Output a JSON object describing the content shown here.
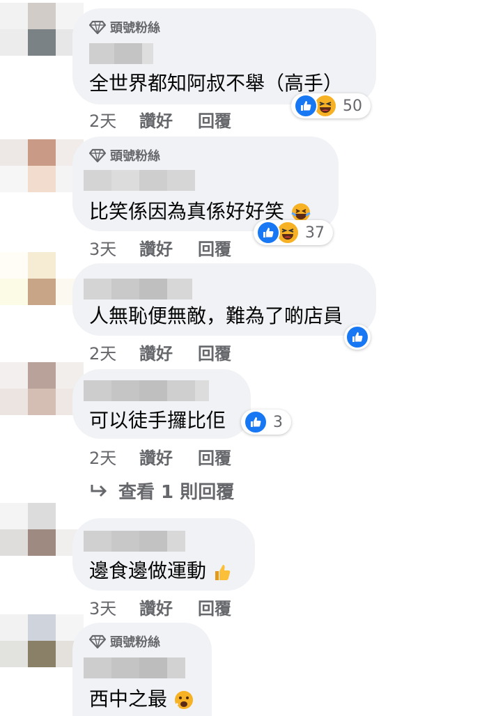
{
  "fan_badge": "頭號粉絲",
  "action_like": "讚好",
  "action_reply": "回覆",
  "view_replies": "查看 1 則回覆",
  "comments": [
    {
      "text": "全世界都知阿叔不舉（高手）",
      "time": "2天",
      "reactions": "50",
      "fan": true
    },
    {
      "text": "比笑係因為真係好好笑",
      "time": "3天",
      "reactions": "37",
      "fan": true
    },
    {
      "text": "人無恥便無敵，難為了啲店員",
      "time": "2天",
      "reactions": "",
      "fan": false
    },
    {
      "text": "可以徒手攞比佢",
      "time": "2天",
      "reactions": "3",
      "fan": false
    },
    {
      "text": "邊食邊做運動",
      "time": "3天",
      "reactions": "",
      "fan": false
    },
    {
      "text": "西中之最",
      "time": "",
      "reactions": "",
      "fan": true
    }
  ]
}
